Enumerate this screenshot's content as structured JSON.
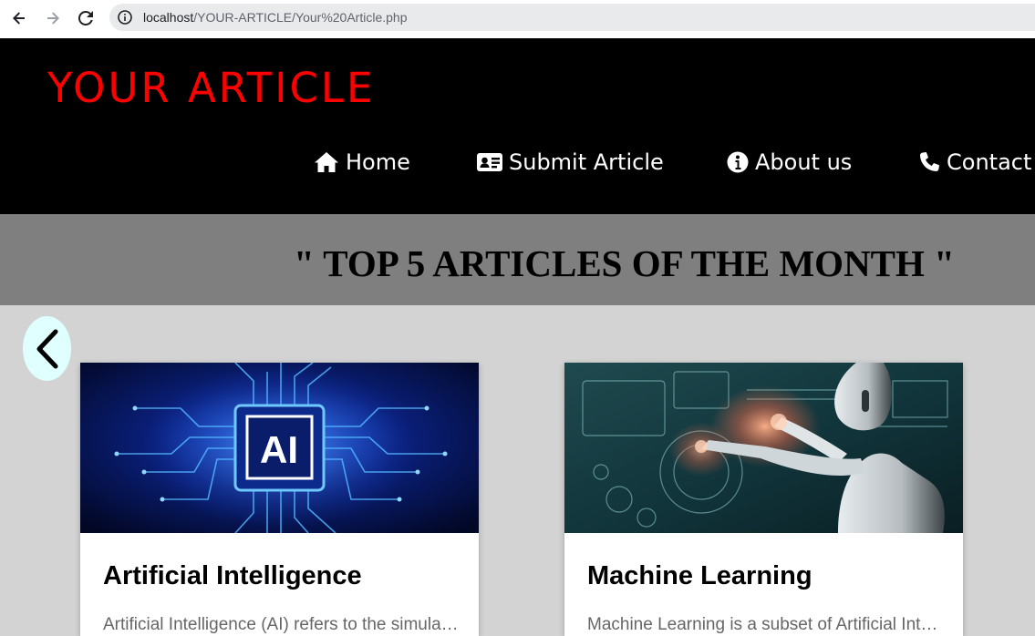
{
  "browser": {
    "url_host": "localhost",
    "url_path": "/YOUR-ARTICLE/Your%20Article.php",
    "icons": [
      "back-arrow-icon",
      "forward-arrow-icon",
      "reload-icon",
      "info-icon"
    ]
  },
  "header": {
    "brand": "YOUR ARTICLE",
    "brand_color": "#ff0000",
    "nav": [
      {
        "label": "Home",
        "icon": "home-icon"
      },
      {
        "label": "Submit Article",
        "icon": "id-card-icon"
      },
      {
        "label": "About us",
        "icon": "info-circle-icon"
      },
      {
        "label": "Contact",
        "icon": "phone-icon"
      }
    ]
  },
  "banner": {
    "title": "\" TOP 5 ARTICLES OF THE MONTH \""
  },
  "carousel": {
    "prev_icon": "chevron-left-icon",
    "cards": [
      {
        "title": "Artificial Intelligence",
        "description": "Artificial Intelligence (AI) refers to the simulation of human intelligence",
        "image": "ai-chip-image"
      },
      {
        "title": "Machine Learning",
        "description": "Machine Learning is a subset of Artificial Intelligence",
        "image": "robot-interface-image"
      }
    ]
  }
}
